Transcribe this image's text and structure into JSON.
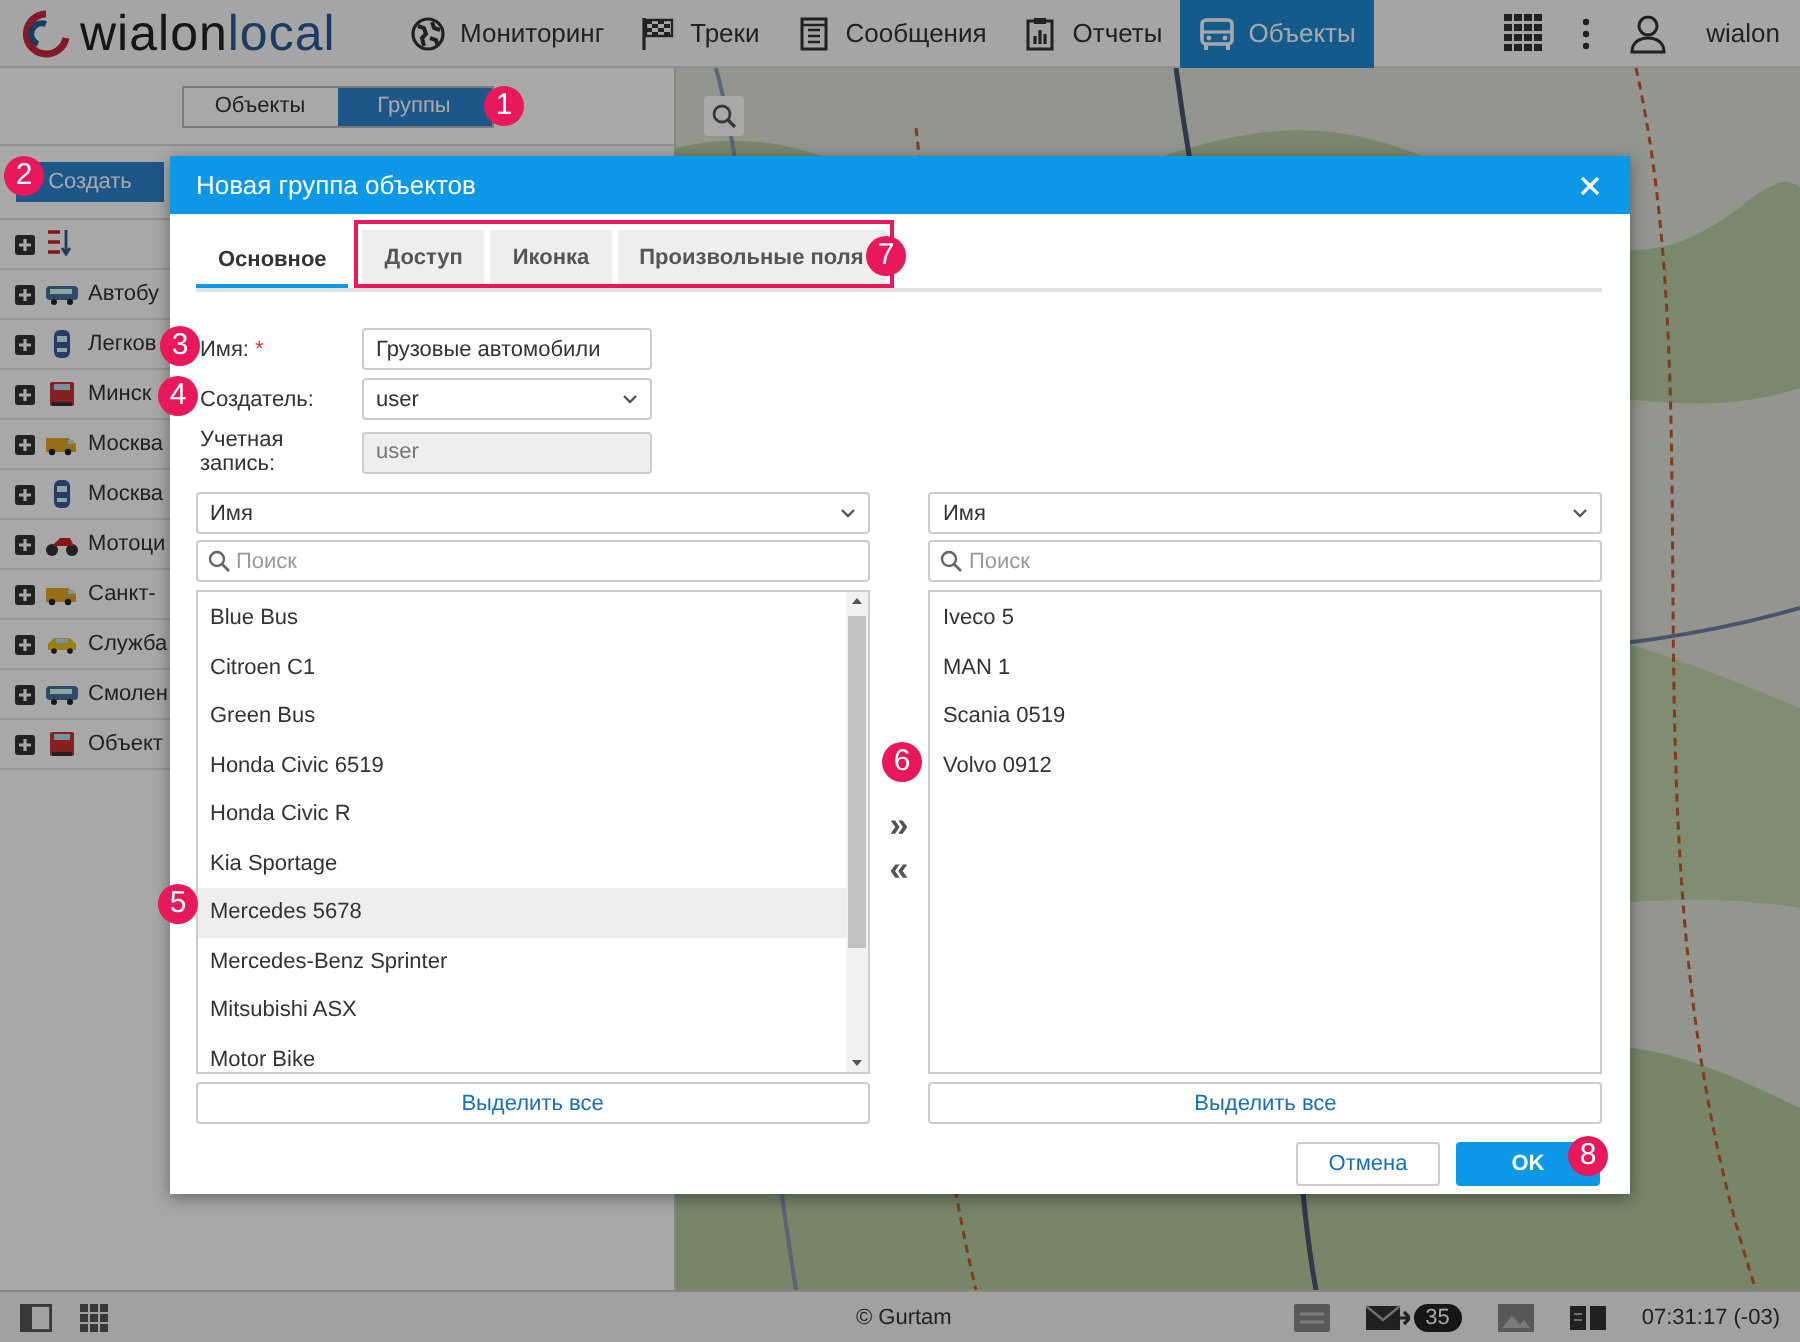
{
  "header": {
    "logo": {
      "primary": "wialon",
      "secondary": "local"
    },
    "nav": [
      {
        "label": "Мониторинг",
        "kind": "globe",
        "selected": false
      },
      {
        "label": "Треки",
        "kind": "flag",
        "selected": false
      },
      {
        "label": "Сообщения",
        "kind": "document",
        "selected": false
      },
      {
        "label": "Отчеты",
        "kind": "report",
        "selected": false
      },
      {
        "label": "Объекты",
        "kind": "bus",
        "selected": true
      }
    ],
    "user": "wialon"
  },
  "sidebar": {
    "toggle": [
      {
        "label": "Объекты",
        "selected": false
      },
      {
        "label": "Группы",
        "selected": true
      }
    ],
    "create_button": "Создать",
    "groups": [
      {
        "name": "Автобу",
        "kind": "bus"
      },
      {
        "name": "Легков",
        "kind": "car"
      },
      {
        "name": "Минск",
        "kind": "truck"
      },
      {
        "name": "Москва",
        "kind": "van"
      },
      {
        "name": "Москва",
        "kind": "car"
      },
      {
        "name": "Мотоци",
        "kind": "moto"
      },
      {
        "name": "Санкт-",
        "kind": "van"
      },
      {
        "name": "Служба",
        "kind": "taxi"
      },
      {
        "name": "Смолен",
        "kind": "bus"
      },
      {
        "name": "Объект",
        "kind": "truck"
      }
    ]
  },
  "dialog": {
    "title": "Новая группа объектов",
    "tabs": [
      {
        "label": "Основное",
        "selected": true,
        "highlighted": false
      },
      {
        "label": "Доступ",
        "selected": false,
        "highlighted": true
      },
      {
        "label": "Иконка",
        "selected": false,
        "highlighted": true
      },
      {
        "label": "Произвольные поля",
        "selected": false,
        "highlighted": true
      }
    ],
    "fields": [
      {
        "label": "Имя:",
        "required_mark": "*",
        "kind": "text",
        "value": "Грузовые автомобили"
      },
      {
        "label": "Создатель:",
        "kind": "select",
        "value": "user"
      },
      {
        "label": "Учетная запись:",
        "kind": "disabled",
        "value": "user"
      }
    ],
    "lists": [
      {
        "sort": "Имя",
        "search_placeholder": "Поиск",
        "scrollbar": true,
        "select_all": "Выделить все",
        "items": [
          {
            "label": "Blue Bus",
            "highlighted": false
          },
          {
            "label": "Citroen C1",
            "highlighted": false
          },
          {
            "label": "Green Bus",
            "highlighted": false
          },
          {
            "label": "Honda Civic 6519",
            "highlighted": false
          },
          {
            "label": "Honda Civic R",
            "highlighted": false
          },
          {
            "label": "Kia Sportage",
            "highlighted": false
          },
          {
            "label": "Mercedes 5678",
            "highlighted": true
          },
          {
            "label": "Mercedes-Benz Sprinter",
            "highlighted": false
          },
          {
            "label": "Mitsubishi ASX",
            "highlighted": false
          },
          {
            "label": "Motor Bike",
            "highlighted": false
          }
        ]
      },
      {
        "sort": "Имя",
        "search_placeholder": "Поиск",
        "scrollbar": false,
        "select_all": "Выделить все",
        "items": [
          {
            "label": "Iveco 5",
            "highlighted": false
          },
          {
            "label": "MAN 1",
            "highlighted": false
          },
          {
            "label": "Scania 0519",
            "highlighted": false
          },
          {
            "label": "Volvo 0912",
            "highlighted": false
          }
        ]
      }
    ],
    "move_buttons": [
      "»",
      "«"
    ],
    "buttons": [
      {
        "label": "Отмена",
        "kind": "secondary"
      },
      {
        "label": "OK",
        "kind": "primary"
      }
    ]
  },
  "footer": {
    "copyright": "© Gurtam",
    "unread": "35",
    "time": "07:31:17 (-03)"
  },
  "callouts": [
    "1",
    "2",
    "3",
    "4",
    "5",
    "6",
    "7",
    "8"
  ]
}
